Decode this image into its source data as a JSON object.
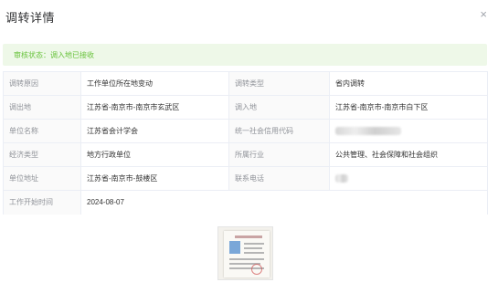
{
  "dialog": {
    "title": "调转详情",
    "close_symbol": "×"
  },
  "status": {
    "text": "审核状态：调入地已接收"
  },
  "rows": [
    {
      "label1": "调转原因",
      "value1": "工作单位所在地变动",
      "label2": "调转类型",
      "value2": "省内调转"
    },
    {
      "label1": "调出地",
      "value1": "江苏省-南京市-南京市玄武区",
      "label2": "调入地",
      "value2": "江苏省-南京市-南京市白下区"
    },
    {
      "label1": "单位名称",
      "value1": "江苏省会计学会",
      "label2": "统一社会信用代码",
      "value2": ""
    },
    {
      "label1": "经济类型",
      "value1": "地方行政单位",
      "label2": "所属行业",
      "value2": "公共管理、社会保障和社会组织"
    },
    {
      "label1": "单位地址",
      "value1": "江苏省-南京市-鼓楼区",
      "label2": "联系电话",
      "value2": ""
    },
    {
      "label1": "工作开始时间",
      "value1": "2024-08-07"
    }
  ],
  "attachment": {
    "icon": "document-thumbnail"
  },
  "colors": {
    "status_bg": "#eef8e8",
    "status_text": "#67c23a",
    "label_text": "#909399",
    "border": "#ebeef5"
  }
}
